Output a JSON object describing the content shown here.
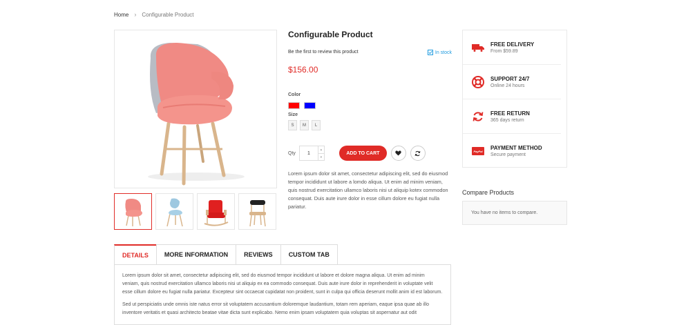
{
  "breadcrumb": {
    "home": "Home",
    "current": "Configurable Product"
  },
  "product": {
    "title": "Configurable Product",
    "review_text": "Be the first to review this product",
    "stock_status": "In stock",
    "price": "$156.00",
    "color_label": "Color",
    "colors": [
      "#ff0000",
      "#0000ff"
    ],
    "size_label": "Size",
    "sizes": [
      "S",
      "M",
      "L"
    ],
    "qty_label": "Qty",
    "qty_value": "1",
    "add_to_cart": "ADD TO CART",
    "description": "Lorem ipsum dolor sit amet, consectetur adipiscing elit, sed do eiusmod tempor incididunt ut labore a lomdo aliqua. Ut enim ad minim veniam, quis nostrud exercitation ullamco laboris nisi ut aliquip kotex commodon consequat. Duis aute irure dolor in esse cillum dolore eu fugiat nulla pariatur."
  },
  "gallery": {
    "thumbnails": [
      "pink-armchair",
      "blue-chair",
      "red-rocking-chair",
      "black-chair"
    ]
  },
  "features": [
    {
      "title": "FREE DELIVERY",
      "subtitle": "From $59.89",
      "icon": "truck-icon"
    },
    {
      "title": "SUPPORT 24/7",
      "subtitle": "Online 24 hours",
      "icon": "lifebuoy-icon"
    },
    {
      "title": "FREE RETURN",
      "subtitle": "365 days return",
      "icon": "return-icon"
    },
    {
      "title": "PAYMENT METHOD",
      "subtitle": "Secure payment",
      "icon": "paypal-icon",
      "icon_text": "PayPal"
    }
  ],
  "compare": {
    "title": "Compare Products",
    "empty_text": "You have no items to compare."
  },
  "tabs": {
    "items": [
      "DETAILS",
      "MORE INFORMATION",
      "REVIEWS",
      "CUSTOM TAB"
    ],
    "active": "DETAILS",
    "content": [
      "Lorem ipsum dolor sit amet, consectetur adipiscing elit, sed do eiusmod tempor incididunt ut labore et dolore magna aliqua. Ut enim ad minim veniam, quis nostrud exercitation ullamco laboris nisi ut aliquip ex ea commodo consequat. Duis aute irure dolor in reprehenderit in voluptate velit esse cillum dolore eu fugiat nulla pariatur. Excepteur sint occaecat cupidatat non proident, sunt in culpa qui officia deserunt mollit anim id est laborum.",
      "Sed ut perspiciatis unde omnis iste natus error sit voluptatem accusantium doloremque laudantium, totam rem aperiam, eaque ipsa quae ab illo inventore veritatis et quasi architecto beatae vitae dicta sunt explicabo. Nemo enim ipsam voluptatem quia voluptas sit aspernatur aut odit"
    ]
  },
  "colors": {
    "accent": "#e02b27",
    "link": "#1e9adf"
  }
}
